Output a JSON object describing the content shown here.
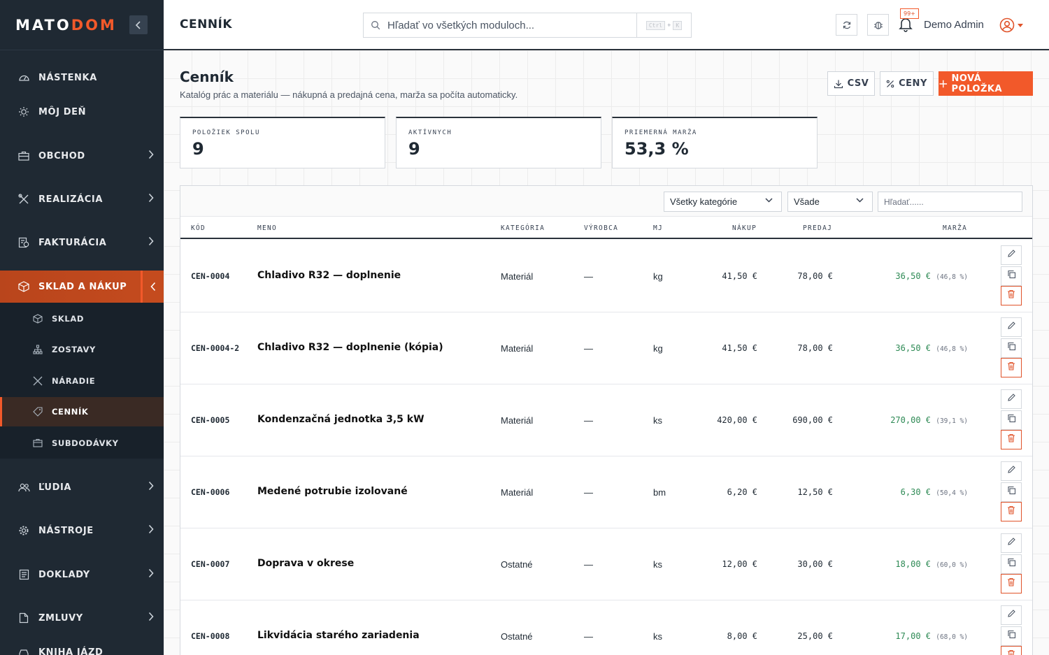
{
  "brand": {
    "logo_part1": "MATO",
    "logo_part2": "DOM",
    "accent": "#f2592a",
    "sidebar_bg": "#1f2933"
  },
  "sidebar": {
    "items": [
      {
        "label": "Nástenka",
        "icon": "gauge-icon"
      },
      {
        "label": "Môj deň",
        "icon": "sun-icon"
      },
      {
        "label": "Obchod",
        "icon": "briefcase-icon"
      },
      {
        "label": "Realizácia",
        "icon": "tools-icon"
      },
      {
        "label": "Fakturácia",
        "icon": "invoice-icon"
      },
      {
        "label": "Sklad a nákup",
        "icon": "box-icon"
      },
      {
        "label": "Ľudia",
        "icon": "people-icon"
      },
      {
        "label": "Nástroje",
        "icon": "gear-icon"
      },
      {
        "label": "Doklady",
        "icon": "document-icon"
      },
      {
        "label": "Zmluvy",
        "icon": "contract-icon"
      },
      {
        "label": "Kniha jázd",
        "icon": "car-icon"
      }
    ],
    "submenu": [
      {
        "label": "Sklad",
        "icon": "cube-icon"
      },
      {
        "label": "Zostavy",
        "icon": "hierarchy-icon"
      },
      {
        "label": "Náradie",
        "icon": "wrench-icon"
      },
      {
        "label": "Cenník",
        "icon": "tag-icon"
      },
      {
        "label": "Subdodávky",
        "icon": "package-icon"
      }
    ]
  },
  "topbar": {
    "title": "Cenník",
    "search_placeholder": "Hľadať vo všetkých moduloch...",
    "kbd_ctrl": "Ctrl",
    "kbd_plus": "+",
    "kbd_k": "K",
    "notifications_badge": "99+",
    "user_name": "Demo Admin"
  },
  "page": {
    "title": "Cenník",
    "subtitle": "Katalóg prác a materiálu — nákupná a predajná cena, marža sa počíta automaticky.",
    "btn_csv": "CSV",
    "btn_prices": "Ceny",
    "btn_new": "Nová položka"
  },
  "stats": [
    {
      "label": "Položiek spolu",
      "value": "9"
    },
    {
      "label": "Aktívnych",
      "value": "9"
    },
    {
      "label": "Priemerná marža",
      "value": "53,3 %"
    }
  ],
  "filters": {
    "category": "Všetky kategórie",
    "scope": "Všade",
    "search_placeholder": "Hľadať......"
  },
  "table": {
    "headers": {
      "code": "Kód",
      "name": "Meno",
      "category": "Kategória",
      "maker": "Výrobca",
      "unit": "MJ",
      "buy": "Nákup",
      "sell": "Predaj",
      "margin": "Marža"
    },
    "rows": [
      {
        "code": "CEN-0004",
        "name": "Chladivo R32 — doplnenie",
        "category": "Materiál",
        "maker": "—",
        "unit": "kg",
        "buy": "41,50 €",
        "sell": "78,00 €",
        "margin": "36,50 €",
        "margin_pct": "(46,8 %)"
      },
      {
        "code": "CEN-0004-2",
        "name": "Chladivo R32 — doplnenie (kópia)",
        "category": "Materiál",
        "maker": "—",
        "unit": "kg",
        "buy": "41,50 €",
        "sell": "78,00 €",
        "margin": "36,50 €",
        "margin_pct": "(46,8 %)"
      },
      {
        "code": "CEN-0005",
        "name": "Kondenzačná jednotka 3,5 kW",
        "category": "Materiál",
        "maker": "—",
        "unit": "ks",
        "buy": "420,00 €",
        "sell": "690,00 €",
        "margin": "270,00 €",
        "margin_pct": "(39,1 %)"
      },
      {
        "code": "CEN-0006",
        "name": "Medené potrubie izolované",
        "category": "Materiál",
        "maker": "—",
        "unit": "bm",
        "buy": "6,20 €",
        "sell": "12,50 €",
        "margin": "6,30 €",
        "margin_pct": "(50,4 %)"
      },
      {
        "code": "CEN-0007",
        "name": "Doprava v okrese",
        "category": "Ostatné",
        "maker": "—",
        "unit": "ks",
        "buy": "12,00 €",
        "sell": "30,00 €",
        "margin": "18,00 €",
        "margin_pct": "(60,0 %)"
      },
      {
        "code": "CEN-0008",
        "name": "Likvidácia starého zariadenia",
        "category": "Ostatné",
        "maker": "—",
        "unit": "ks",
        "buy": "8,00 €",
        "sell": "25,00 €",
        "margin": "17,00 €",
        "margin_pct": "(68,0 %)"
      }
    ]
  }
}
